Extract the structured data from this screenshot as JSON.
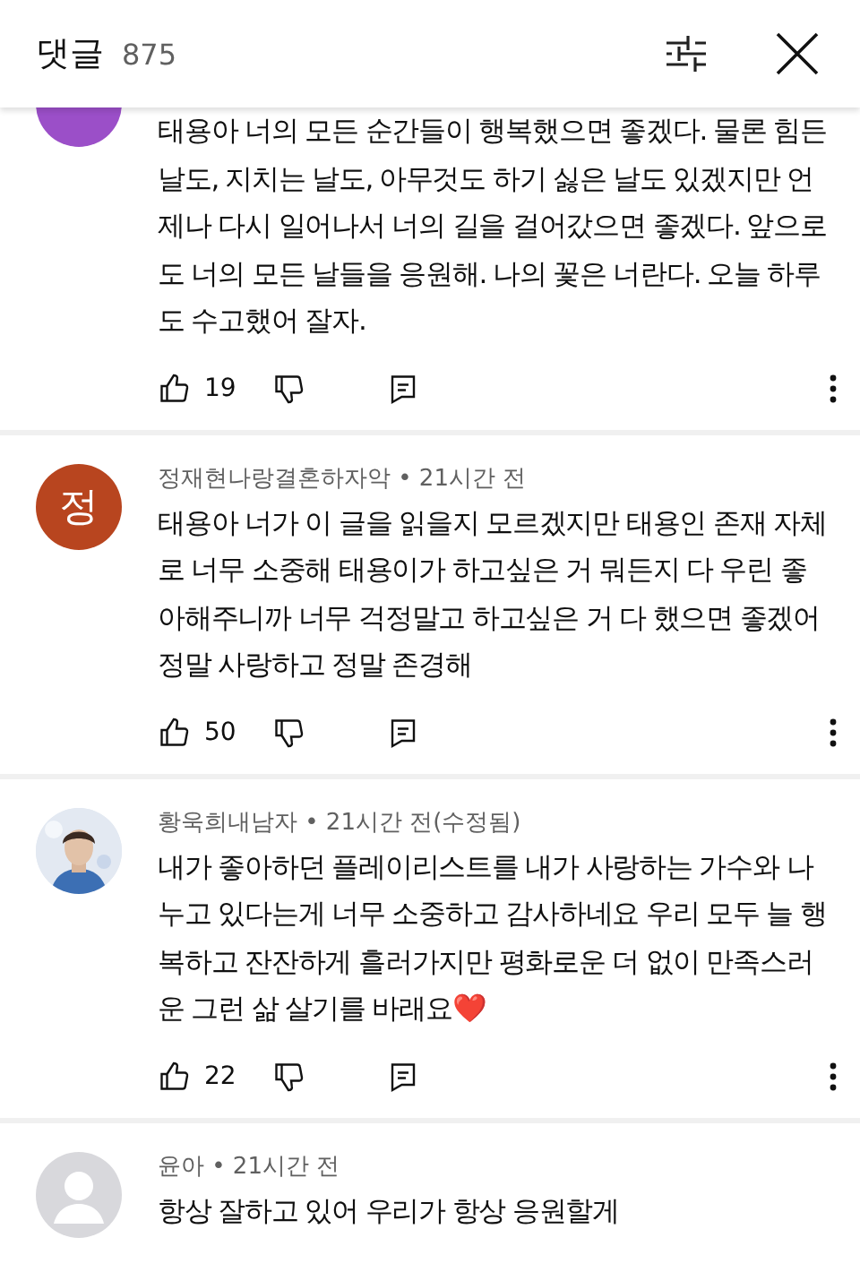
{
  "header": {
    "title": "댓글",
    "count": "875"
  },
  "comments": [
    {
      "avatar": {
        "kind": "letter",
        "color": "#9b4fc8"
      },
      "text": "태용아 너의 모든 순간들이 행복했으면 좋겠다. 물론 힘든 날도, 지치는 날도, 아무것도 하기 싫은 날도 있겠지만 언제나 다시 일어나서 너의 길을 걸어갔으면 좋겠다. 앞으로도 너의 모든 날들을 응원해. 나의 꽃은 너란다. 오늘 하루도 수고했어 잘자.",
      "likes": "19"
    },
    {
      "avatar": {
        "kind": "letter",
        "color": "#b8451f",
        "letter": "정"
      },
      "meta": "정재현나랑결혼하자악 • 21시간 전",
      "text": "태용아 너가 이 글을 읽을지 모르겠지만 태용인 존재 자체로 너무 소중해 태용이가 하고싶은 거 뭐든지 다 우린 좋아해주니까 너무 걱정말고 하고싶은 거 다 했으면 좋겠어 정말 사랑하고 정말 존경해",
      "likes": "50"
    },
    {
      "meta": "황욱희내남자 • 21시간 전(수정됨)",
      "text": "내가 좋아하던 플레이리스트를 내가 사랑하는 가수와 나누고 있다는게 너무 소중하고 감사하네요  우리 모두  늘 행복하고 잔잔하게 흘러가지만 평화로운 더 없이 만족스러운 그런 삶 살기를 바래요❤️",
      "likes": "22"
    },
    {
      "avatar": {
        "kind": "default"
      },
      "meta": "윤아 • 21시간 전",
      "text": "항상 잘하고 있어 우리가 항상 응원할게"
    }
  ]
}
